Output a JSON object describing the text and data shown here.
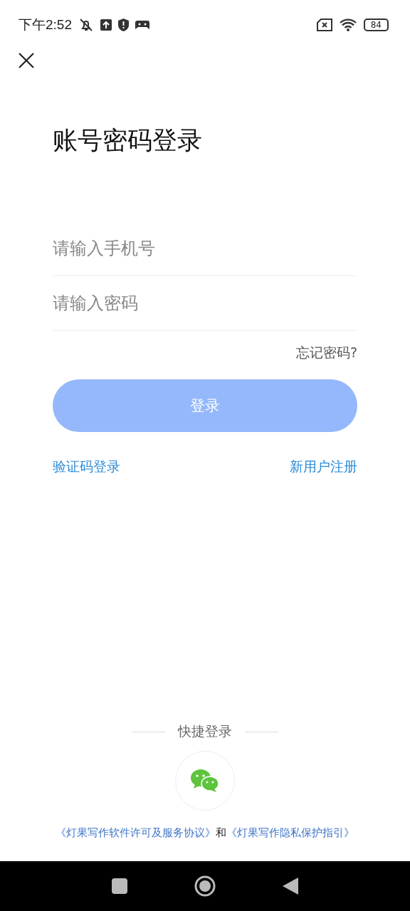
{
  "status_bar": {
    "time": "下午2:52",
    "battery": "84"
  },
  "title": "账号密码登录",
  "fields": [
    {
      "placeholder": "请输入手机号"
    },
    {
      "placeholder": "请输入密码"
    }
  ],
  "forgot_link": "忘记密码?",
  "login_button": {
    "label": "登录",
    "disabled": true
  },
  "links": [
    "验证码登录",
    "新用户注册"
  ],
  "quick_login": {
    "label": "快捷登录"
  },
  "agreement": {
    "links": [
      "《灯果写作软件许可及服务协议》",
      "《灯果写作隐私保护指引》"
    ],
    "joiner": "和"
  }
}
